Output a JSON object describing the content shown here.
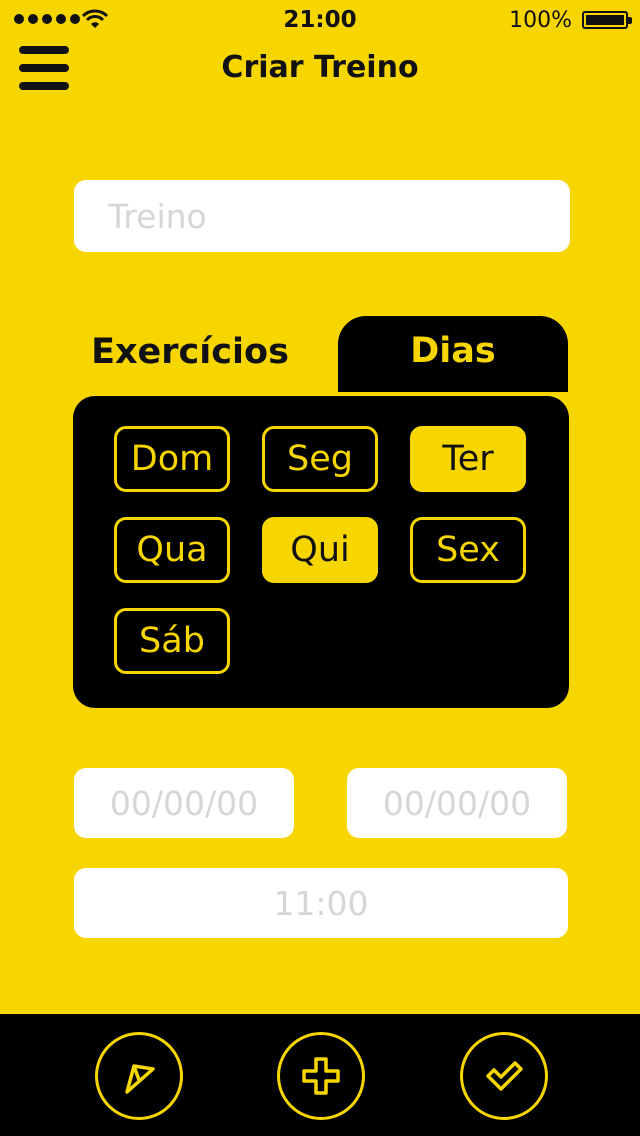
{
  "status": {
    "time": "21:00",
    "battery": "100%"
  },
  "header": {
    "title": "Criar Treino"
  },
  "form": {
    "treino_placeholder": "Treino",
    "treino_value": "",
    "date_start_placeholder": "00/00/00",
    "date_end_placeholder": "00/00/00",
    "time_placeholder": "11:00"
  },
  "tabs": [
    {
      "label": "Exercícios",
      "selected": false
    },
    {
      "label": "Dias",
      "selected": true
    }
  ],
  "days": [
    {
      "label": "Dom",
      "selected": false
    },
    {
      "label": "Seg",
      "selected": false
    },
    {
      "label": "Ter",
      "selected": true
    },
    {
      "label": "Qua",
      "selected": false
    },
    {
      "label": "Qui",
      "selected": true
    },
    {
      "label": "Sex",
      "selected": false
    },
    {
      "label": "Sáb",
      "selected": false
    }
  ],
  "colors": {
    "accent": "#f7d600",
    "dark": "#000000",
    "field": "#ffffff"
  },
  "icons": {
    "menu": "menu-icon",
    "send": "send-icon",
    "add": "plus-icon",
    "confirm": "check-icon"
  }
}
